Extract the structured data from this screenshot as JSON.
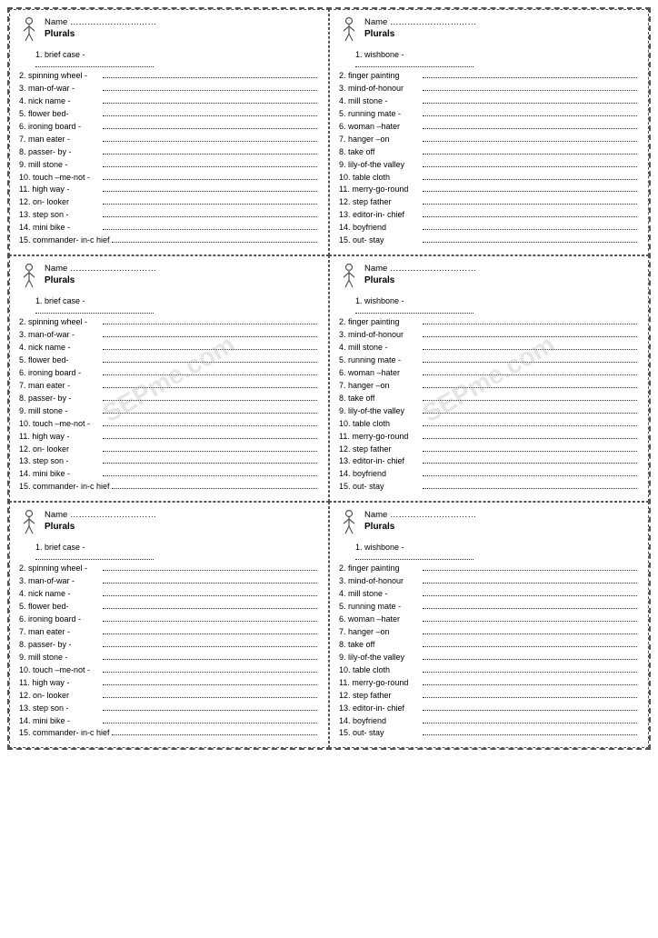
{
  "cells": [
    {
      "id": "top-left-1",
      "name_label": "Name …………………………",
      "section": "Plurals",
      "first_item": "1.  brief case -",
      "first_dots": true,
      "items": [
        "2. spinning wheel -",
        "3. man-of-war -",
        "4. nick name -",
        "5. flower bed-",
        "6. ironing board -",
        "7. man eater -",
        "8. passer- by -",
        "9. mill stone -",
        "10. touch –me-not -",
        "11. high way -",
        "12. on- looker",
        "13. step son -",
        "14. mini bike -",
        "15. commander- in-c hief"
      ],
      "watermark": false
    },
    {
      "id": "top-right-1",
      "name_label": "Name …………………………",
      "section": "Plurals",
      "first_item": "1.  wishbone -",
      "first_dots": true,
      "items": [
        "2. finger painting",
        "3. mind-of-honour",
        "4. mill stone -",
        "5. running mate -",
        "6. woman –hater",
        "7. hanger –on",
        "8. take off",
        "9. lily-of-the valley",
        "10. table cloth",
        "11. merry-go-round",
        "12. step father",
        "13. editor-in- chief",
        "14. boyfriend",
        "15. out- stay"
      ],
      "watermark": false
    },
    {
      "id": "mid-left-1",
      "name_label": "Name …………………………",
      "section": "Plurals",
      "first_item": "1.  brief case -",
      "first_dots": true,
      "items": [
        "2. spinning wheel -",
        "3. man-of-war -",
        "4. nick name -",
        "5. flower bed-",
        "6. ironing board -",
        "7. man eater -",
        "8. passer- by -",
        "9. mill stone -",
        "10. touch –me-not -",
        "11. high way -",
        "12. on- looker",
        "13. step son -",
        "14. mini bike -",
        "15. commander- in-c hief"
      ],
      "watermark": true
    },
    {
      "id": "mid-right-1",
      "name_label": "Name …………………………",
      "section": "Plurals",
      "first_item": "1.  wishbone -",
      "first_dots": true,
      "items": [
        "2. finger painting",
        "3. mind-of-honour",
        "4. mill stone -",
        "5. running mate -",
        "6. woman –hater",
        "7. hanger –on",
        "8. take off",
        "9. lily-of-the valley",
        "10. table cloth",
        "11. merry-go-round",
        "12. step father",
        "13. editor-in- chief",
        "14. boyfriend",
        "15. out- stay"
      ],
      "watermark": true
    },
    {
      "id": "bot-left-1",
      "name_label": "Name …………………………",
      "section": "Plurals",
      "first_item": "1.  brief case -",
      "first_dots": true,
      "items": [
        "2. spinning wheel -",
        "3. man-of-war -",
        "4. nick name -",
        "5. flower bed-",
        "6. ironing board -",
        "7. man eater -",
        "8. passer- by -",
        "9. mill stone -",
        "10. touch –me-not -",
        "11. high way -",
        "12. on- looker",
        "13. step son -",
        "14. mini bike -",
        "15. commander- in-c hief"
      ],
      "watermark": false
    },
    {
      "id": "bot-right-1",
      "name_label": "Name …………………………",
      "section": "Plurals",
      "first_item": "1.  wishbone -",
      "first_dots": true,
      "items": [
        "2. finger painting",
        "3. mind-of-honour",
        "4. mill stone -",
        "5. running mate -",
        "6. woman –hater",
        "7. hanger –on",
        "8. take off",
        "9. lily-of-the valley",
        "10. table cloth",
        "11. merry-go-round",
        "12. step father",
        "13. editor-in- chief",
        "14. boyfriend",
        "15. out- stay"
      ],
      "watermark": false
    }
  ],
  "watermark_text": "SEPme.com"
}
